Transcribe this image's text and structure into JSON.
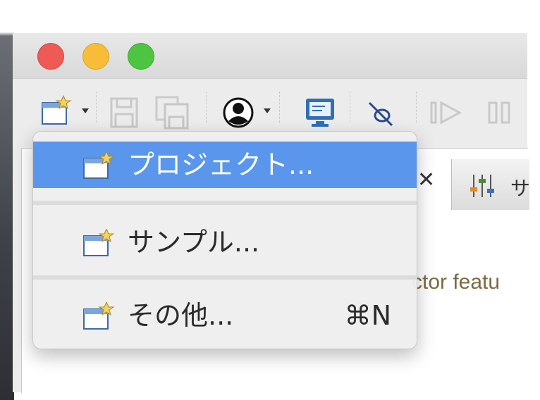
{
  "menu": {
    "items": [
      {
        "label": "プロジェクト...",
        "shortcut": "",
        "selected": true,
        "icon": "new-wizard-icon"
      },
      {
        "label": "サンプル...",
        "shortcut": "",
        "selected": false,
        "icon": "new-wizard-icon"
      },
      {
        "label": "その他...",
        "shortcut": "⌘N",
        "selected": false,
        "icon": "new-wizard-icon"
      }
    ]
  },
  "tabs": {
    "right_tab_label": "サ"
  },
  "editor": {
    "snippet": "ctor featu"
  },
  "colors": {
    "selection": "#5a96ec",
    "close": "#ee5b55",
    "minimize": "#f7bd37",
    "maximize": "#4ec443"
  }
}
